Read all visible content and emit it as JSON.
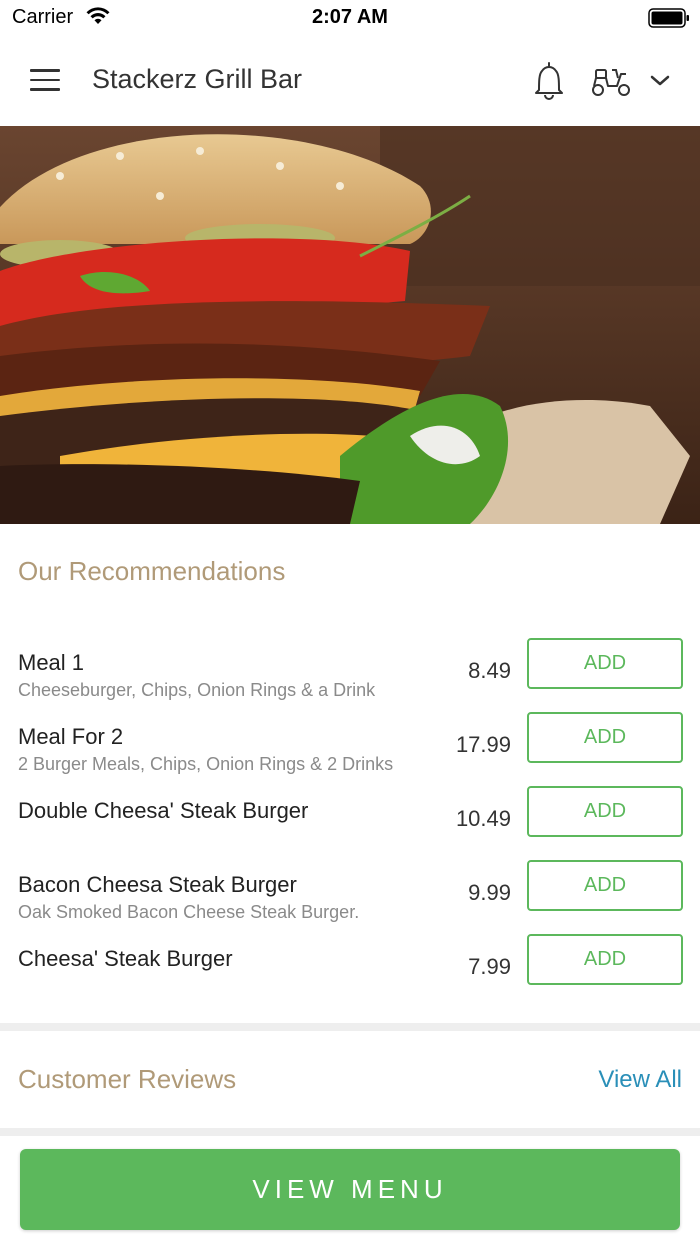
{
  "status_bar": {
    "carrier": "Carrier",
    "time": "2:07 AM"
  },
  "header": {
    "title": "Stackerz Grill Bar",
    "icons": [
      "menu-icon",
      "bell-icon",
      "scooter-icon",
      "chevron-down-icon"
    ]
  },
  "hero": {
    "subject": "burger-image"
  },
  "recommendations": {
    "heading": "Our Recommendations",
    "items": [
      {
        "name": "Meal 1",
        "description": "Cheeseburger, Chips, Onion Rings & a Drink",
        "price": "8.49",
        "button": "ADD"
      },
      {
        "name": "Meal For 2",
        "description": "2 Burger Meals, Chips, Onion Rings & 2 Drinks",
        "price": "17.99",
        "button": "ADD"
      },
      {
        "name": "Double Cheesa' Steak Burger",
        "description": "",
        "price": "10.49",
        "button": "ADD"
      },
      {
        "name": "Bacon Cheesa Steak Burger",
        "description": "Oak Smoked Bacon Cheese Steak Burger.",
        "price": "9.99",
        "button": "ADD"
      },
      {
        "name": "Cheesa' Steak Burger",
        "description": "",
        "price": "7.99",
        "button": "ADD"
      }
    ]
  },
  "reviews": {
    "heading": "Customer Reviews",
    "view_all": "View All"
  },
  "footer": {
    "button": "VIEW MENU"
  },
  "colors": {
    "accent_green": "#5cb85c",
    "heading_tan": "#b09a78",
    "link_blue": "#2a8fb8"
  }
}
